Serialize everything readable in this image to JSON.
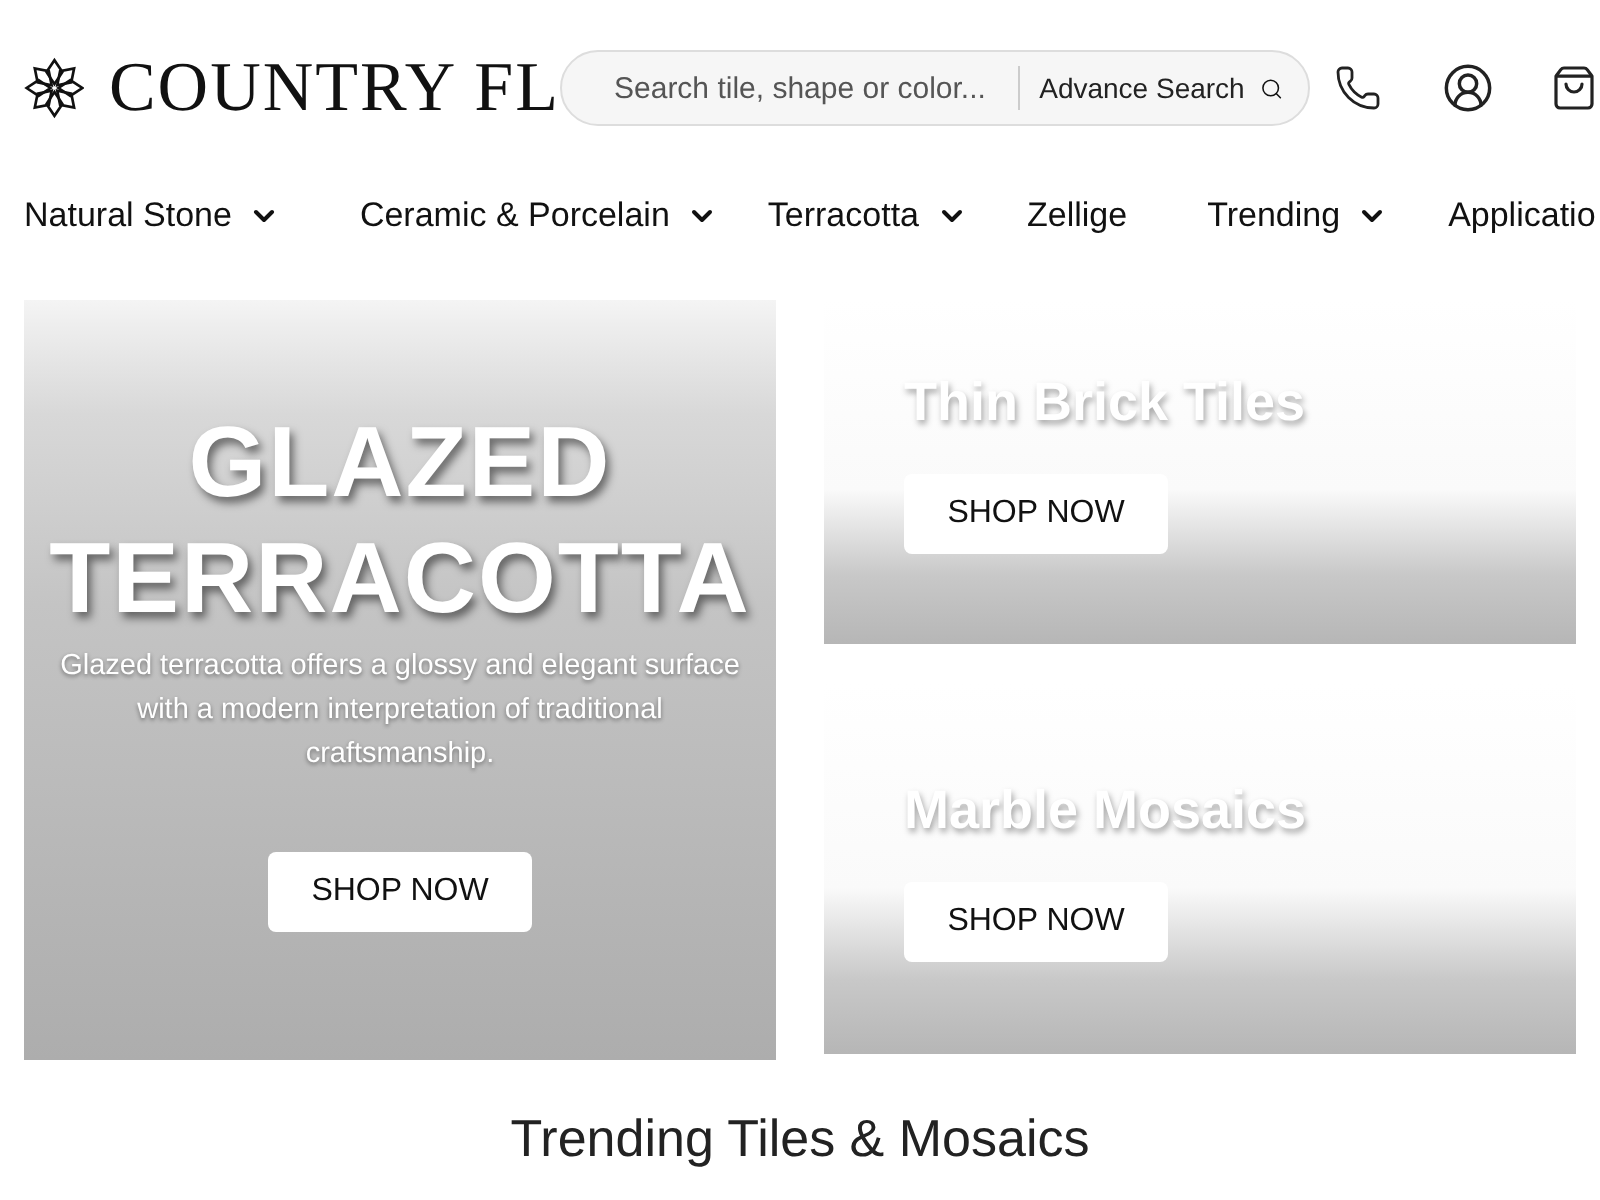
{
  "header": {
    "logo": "COUNTRY FL",
    "search": {
      "placeholder": "Search tile, shape or color...",
      "advance_label": "Advance Search"
    }
  },
  "nav": [
    {
      "label": "Natural Stone",
      "dropdown": true
    },
    {
      "label": "Ceramic & Porcelain",
      "dropdown": true
    },
    {
      "label": "Terracotta",
      "dropdown": true
    },
    {
      "label": "Zellige",
      "dropdown": false
    },
    {
      "label": "Trending",
      "dropdown": true
    },
    {
      "label": "Applicatio",
      "dropdown": false
    }
  ],
  "hero": {
    "title_lines": [
      "GLAZED",
      "TERRACOTTA"
    ],
    "description": "Glazed terracotta offers a glossy and elegant surface with a modern interpretation of traditional craftsmanship.",
    "button": "SHOP NOW"
  },
  "promos": [
    {
      "title": "Thin Brick Tiles",
      "button": "SHOP NOW"
    },
    {
      "title": "Marble Mosaics",
      "button": "SHOP NOW"
    }
  ],
  "section_heading": "Trending Tiles & Mosaics"
}
